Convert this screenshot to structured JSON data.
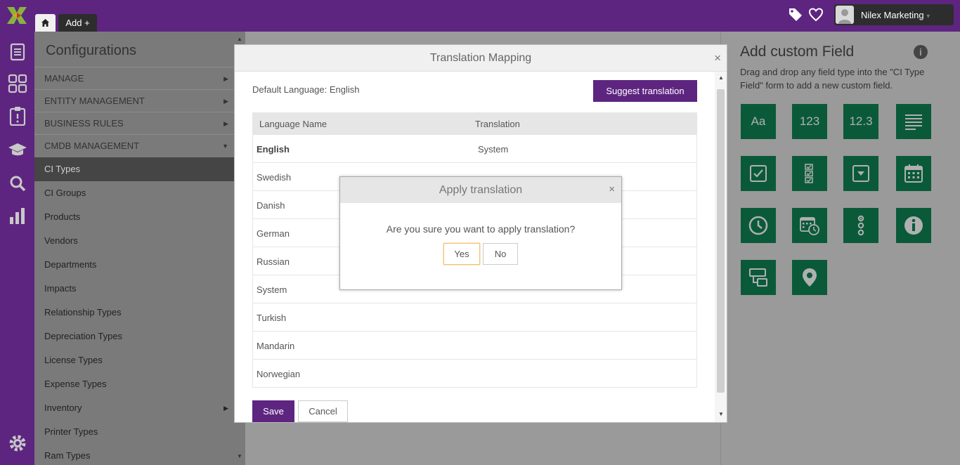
{
  "topbar": {
    "home_label": "",
    "add_label": "Add +",
    "user_name": "Nilex Marketing",
    "user_caret": "▾"
  },
  "sidebar": {
    "title": "Configurations",
    "sections": [
      {
        "label": "MANAGE",
        "arrow": "▶"
      },
      {
        "label": "ENTITY MANAGEMENT",
        "arrow": "▶"
      },
      {
        "label": "BUSINESS RULES",
        "arrow": "▶"
      },
      {
        "label": "CMDB MANAGEMENT",
        "arrow": "▼"
      }
    ],
    "items": [
      {
        "label": "CI Types",
        "active": true
      },
      {
        "label": "CI Groups"
      },
      {
        "label": "Products"
      },
      {
        "label": "Vendors"
      },
      {
        "label": "Departments"
      },
      {
        "label": "Impacts"
      },
      {
        "label": "Relationship Types"
      },
      {
        "label": "Depreciation Types"
      },
      {
        "label": "License Types"
      },
      {
        "label": "Expense Types"
      },
      {
        "label": "Inventory",
        "arrow": "▶"
      },
      {
        "label": "Printer Types"
      },
      {
        "label": "Ram Types"
      }
    ]
  },
  "right_panel": {
    "title": "Add custom Field",
    "description": "Drag and drop any field type into the \"CI Type Field\" form to add a new custom field.",
    "tiles": [
      {
        "name": "text-field-tile",
        "label": "Aa"
      },
      {
        "name": "integer-field-tile",
        "label": "123"
      },
      {
        "name": "decimal-field-tile",
        "label": "12.3"
      },
      {
        "name": "textarea-field-tile",
        "icon": "paragraph-icon"
      },
      {
        "name": "checkbox-field-tile",
        "icon": "checkbox-icon"
      },
      {
        "name": "checklist-field-tile",
        "icon": "checklist-icon"
      },
      {
        "name": "dropdown-field-tile",
        "icon": "dropdown-icon"
      },
      {
        "name": "date-field-tile",
        "icon": "calendar-icon"
      },
      {
        "name": "time-field-tile",
        "icon": "clock-icon"
      },
      {
        "name": "datetime-field-tile",
        "icon": "calendar-clock-icon"
      },
      {
        "name": "radio-field-tile",
        "icon": "radio-list-icon"
      },
      {
        "name": "info-field-tile",
        "icon": "info-icon"
      },
      {
        "name": "relation-field-tile",
        "icon": "relation-icon"
      },
      {
        "name": "location-field-tile",
        "icon": "location-pin-icon"
      }
    ]
  },
  "translation_modal": {
    "title": "Translation Mapping",
    "close": "×",
    "default_language": "Default Language: English",
    "suggest_label": "Suggest translation",
    "columns": [
      "Language Name",
      "Translation"
    ],
    "rows": [
      {
        "language": "English",
        "translation": "System",
        "bold": true
      },
      {
        "language": "Swedish",
        "translation": ""
      },
      {
        "language": "Danish",
        "translation": ""
      },
      {
        "language": "German",
        "translation": ""
      },
      {
        "language": "Russian",
        "translation": ""
      },
      {
        "language": "System",
        "translation": ""
      },
      {
        "language": "Turkish",
        "translation": ""
      },
      {
        "language": "Mandarin",
        "translation": ""
      },
      {
        "language": "Norwegian",
        "translation": ""
      }
    ],
    "save_label": "Save",
    "cancel_label": "Cancel"
  },
  "confirm_dialog": {
    "title": "Apply translation",
    "close": "×",
    "message": "Are you sure you want to apply translation?",
    "yes_label": "Yes",
    "no_label": "No"
  },
  "colors": {
    "brand_purple": "#5d2580",
    "field_green": "#0a5a3a",
    "sidebar_active": "#454545"
  }
}
